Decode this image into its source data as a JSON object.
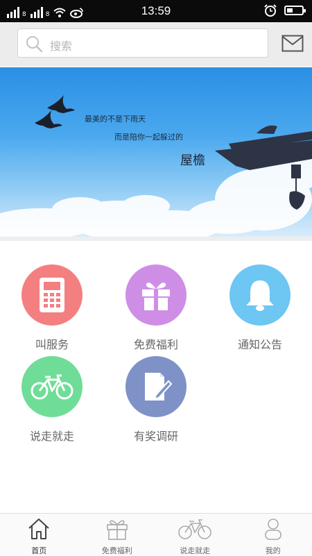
{
  "status": {
    "time": "13:59",
    "network_tag": "8"
  },
  "search": {
    "placeholder": "搜索"
  },
  "banner": {
    "line1": "最美的不是下雨天",
    "line2": "而是陪你一起躲过的",
    "big": "屋檐"
  },
  "grid": [
    {
      "label": "叫服务",
      "color": "#f47f80",
      "icon": "phone-icon"
    },
    {
      "label": "免费福利",
      "color": "#cf8ee6",
      "icon": "gift-icon"
    },
    {
      "label": "通知公告",
      "color": "#6ec6f3",
      "icon": "bell-icon"
    },
    {
      "label": "说走就走",
      "color": "#6fdd97",
      "icon": "bicycle-icon"
    },
    {
      "label": "有奖调研",
      "color": "#7e92c8",
      "icon": "survey-icon"
    }
  ],
  "tabs": [
    {
      "label": "首页",
      "icon": "home-icon"
    },
    {
      "label": "免费福利",
      "icon": "gift-icon"
    },
    {
      "label": "说走就走",
      "icon": "bicycle-icon"
    },
    {
      "label": "我的",
      "icon": "user-icon"
    }
  ]
}
